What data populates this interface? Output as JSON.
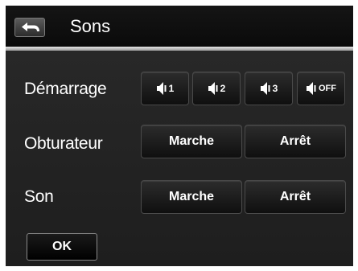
{
  "header": {
    "title": "Sons",
    "back_icon": "back-arrow-icon"
  },
  "rows": {
    "demarrage": {
      "label": "Démarrage",
      "options": [
        {
          "icon": "speaker-icon",
          "label": "1"
        },
        {
          "icon": "speaker-icon",
          "label": "2"
        },
        {
          "icon": "speaker-icon",
          "label": "3"
        },
        {
          "icon": "speaker-icon",
          "label": "OFF"
        }
      ]
    },
    "obturateur": {
      "label": "Obturateur",
      "on_label": "Marche",
      "off_label": "Arrêt"
    },
    "son": {
      "label": "Son",
      "on_label": "Marche",
      "off_label": "Arrêt"
    }
  },
  "footer": {
    "ok_label": "OK"
  }
}
